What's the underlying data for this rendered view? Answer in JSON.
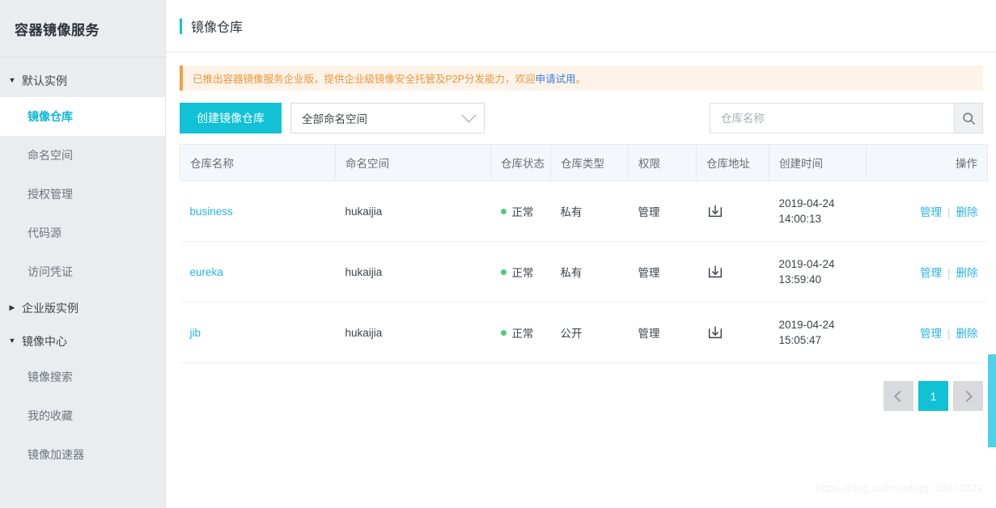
{
  "sidebar": {
    "title": "容器镜像服务",
    "groups": [
      {
        "label": "默认实例",
        "caret": "caret-down-icon",
        "items": [
          {
            "label": "镜像仓库",
            "active": true
          },
          {
            "label": "命名空间",
            "active": false
          },
          {
            "label": "授权管理",
            "active": false
          },
          {
            "label": "代码源",
            "active": false
          },
          {
            "label": "访问凭证",
            "active": false
          }
        ]
      },
      {
        "label": "企业版实例",
        "caret": "caret-right-icon",
        "items": []
      },
      {
        "label": "镜像中心",
        "caret": "caret-down-icon",
        "items": [
          {
            "label": "镜像搜索",
            "active": false
          },
          {
            "label": "我的收藏",
            "active": false
          },
          {
            "label": "镜像加速器",
            "active": false
          }
        ]
      }
    ]
  },
  "header": {
    "title": "镜像仓库"
  },
  "notice": {
    "text_before": "已推出容器镜像服务企业版，提供企业级镜像安全托管及P2P分发能力，欢迎",
    "link": "申请试用",
    "text_after": "。"
  },
  "toolbar": {
    "create_label": "创建镜像仓库",
    "namespace_select": "全部命名空间",
    "chevron": "chevron-down-icon",
    "search_placeholder": "仓库名称",
    "search_value": "",
    "search_icon": "search-icon"
  },
  "table": {
    "columns": [
      "仓库名称",
      "命名空间",
      "仓库状态",
      "仓库类型",
      "权限",
      "仓库地址",
      "创建时间",
      "操作"
    ],
    "rows": [
      {
        "name": "business",
        "namespace": "hukaijia",
        "status": "正常",
        "type": "私有",
        "permission": "管理",
        "address_icon": "download-icon",
        "created_date": "2019-04-24",
        "created_time": "14:00:13",
        "op_manage": "管理",
        "op_delete": "删除"
      },
      {
        "name": "eureka",
        "namespace": "hukaijia",
        "status": "正常",
        "type": "私有",
        "permission": "管理",
        "address_icon": "download-icon",
        "created_date": "2019-04-24",
        "created_time": "13:59:40",
        "op_manage": "管理",
        "op_delete": "删除"
      },
      {
        "name": "jib",
        "namespace": "hukaijia",
        "status": "正常",
        "type": "公开",
        "permission": "管理",
        "address_icon": "download-icon",
        "created_date": "2019-04-24",
        "created_time": "15:05:47",
        "op_manage": "管理",
        "op_delete": "删除"
      }
    ]
  },
  "pagination": {
    "prev_icon": "chevron-left-icon",
    "next_icon": "chevron-right-icon",
    "current_page": "1"
  },
  "watermark": "https://blog.csdn.net/qq_33430322",
  "colors": {
    "accent": "#11c1d6",
    "link": "#27b3e0",
    "notice_bg": "#fdf3e8",
    "notice_border": "#f0a042",
    "notice_text": "#e8983c",
    "status_dot": "#52c97a",
    "sidebar_bg": "#e9edf0"
  }
}
